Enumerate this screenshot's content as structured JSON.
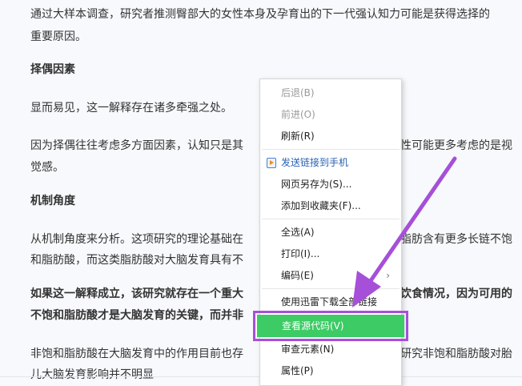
{
  "article": {
    "p1_line1": "通过大样本调查，研究者推测臀部大的女性本身及孕育出的下一代强认知力可能是获得选择的",
    "p1_line2": "重要原因。",
    "h1": "择偶因素",
    "p2": "显而易见，这一解释存在诸多牵强之处。",
    "p3_line1_left": "因为择偶往往考虑多方面因素，认知只是其",
    "p3_line1_right": "性可能更多考虑的是视",
    "p3_line2": "觉感。",
    "h2": "机制角度",
    "p4_line1_left": "从机制角度来分析。这项研究的理论基础在",
    "p4_line1_right": "脂肪含有更多长链不饱",
    "p4_line2_left": "和脂肪酸，而这类脂肪酸对大脑发育具有不",
    "p5_line1_left": "如果这一解释成立，该研究就存在一个重大",
    "p5_line1_right": "饮食情况，因为可用的",
    "p5_line2_left": "不饱和脂肪酸才是大脑发育的关键，而并非",
    "p6_line1_left": "非饱和脂肪酸在大脑发育中的作用目前也存",
    "p6_line1_right": "研究非饱和脂肪酸对胎",
    "p6_line2": "儿大脑发育影响并不明显"
  },
  "context_menu": {
    "back": "后退(B)",
    "forward": "前进(O)",
    "refresh": "刷新(R)",
    "send_to_phone": "发送链接到手机",
    "save_as": "网页另存为(S)...",
    "add_favorite": "添加到收藏夹(F)...",
    "select_all": "全选(A)",
    "print": "打印(I)...",
    "encoding": "编码(E)",
    "encoding_arrow": "›",
    "download_all": "使用迅雷下载全部链接",
    "view_source": "查看源代码(V)",
    "inspect": "审查元素(N)",
    "properties": "属性(P)"
  },
  "colors": {
    "highlight_green": "#3ccb64",
    "annotation_purple": "#a64fd8",
    "link_blue": "#2962b0"
  },
  "icons": {
    "send_to_phone": "phone-send-icon",
    "submenu": "chevron-right-icon",
    "annotation": "arrow-annotation"
  }
}
